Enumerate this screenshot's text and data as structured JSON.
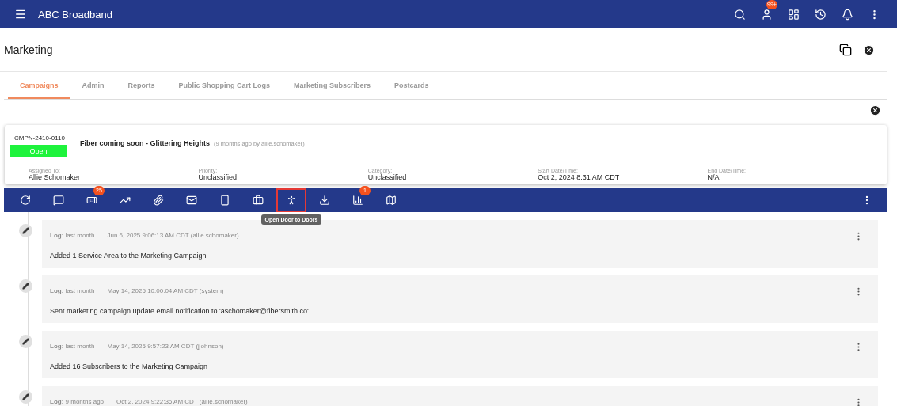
{
  "app_bar": {
    "title": "ABC Broadband",
    "user_badge": "99+"
  },
  "page": {
    "title": "Marketing"
  },
  "tabs": [
    {
      "label": "Campaigns",
      "selected": true
    },
    {
      "label": "Admin",
      "selected": false
    },
    {
      "label": "Reports",
      "selected": false
    },
    {
      "label": "Public Shopping Cart Logs",
      "selected": false
    },
    {
      "label": "Marketing Subscribers",
      "selected": false
    },
    {
      "label": "Postcards",
      "selected": false
    }
  ],
  "campaign": {
    "id": "CMPN-2410-0110",
    "status": "Open",
    "title": "Fiber coming soon - Glittering Heights",
    "meta": "(9 months ago by allie.schomaker)",
    "fields": [
      {
        "label": "Assigned To:",
        "value": "Allie Schomaker"
      },
      {
        "label": "Priority:",
        "value": "Unclassified"
      },
      {
        "label": "Category:",
        "value": "Unclassified"
      },
      {
        "label": "Start Date/Time:",
        "value": "Oct 2, 2024 8:31 AM CDT"
      },
      {
        "label": "End Date/Time:",
        "value": "N/A"
      }
    ]
  },
  "toolbar": {
    "tooltip": "Open Door to Doors",
    "items": [
      {
        "highlighted": false
      },
      {
        "highlighted": false
      },
      {
        "highlighted": false,
        "badge": "25"
      },
      {
        "highlighted": false
      },
      {
        "highlighted": false
      },
      {
        "highlighted": false
      },
      {
        "highlighted": false
      },
      {
        "highlighted": false
      },
      {
        "highlighted": true
      },
      {
        "highlighted": false
      },
      {
        "highlighted": false,
        "badge": "1"
      },
      {
        "highlighted": false
      }
    ]
  },
  "logs": [
    {
      "label": "Log:",
      "when": "last month",
      "stamp": "Jun 6, 2025 9:06:13 AM CDT (allie.schomaker)",
      "message": "Added 1 Service Area to the Marketing Campaign"
    },
    {
      "label": "Log:",
      "when": "last month",
      "stamp": "May 14, 2025 10:00:04 AM CDT (system)",
      "message": "Sent marketing campaign update email notification to 'aschomaker@fibersmith.co'."
    },
    {
      "label": "Log:",
      "when": "last month",
      "stamp": "May 14, 2025 9:57:23 AM CDT (jjohnson)",
      "message": "Added 16 Subscribers to the Marketing Campaign"
    },
    {
      "label": "Log:",
      "when": "9 months ago",
      "stamp": "Oct 2, 2024 9:22:36 AM CDT (allie.schomaker)"
    }
  ]
}
